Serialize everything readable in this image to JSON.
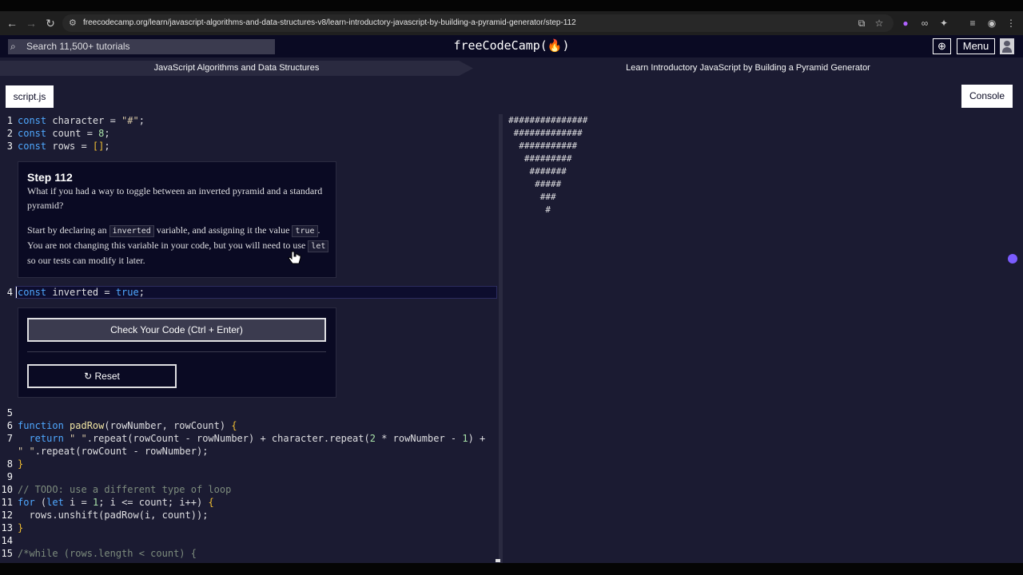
{
  "browser": {
    "url": "freecodecamp.org/learn/javascript-algorithms-and-data-structures-v8/learn-introductory-javascript-by-building-a-pyramid-generator/step-112"
  },
  "nav": {
    "search_placeholder": "Search 11,500+ tutorials",
    "brand": "freeCodeCamp(🔥)",
    "menu_label": "Menu"
  },
  "breadcrumb": {
    "superblock": "JavaScript Algorithms and Data Structures",
    "block": "Learn Introductory JavaScript by Building a Pyramid Generator"
  },
  "toolbar": {
    "file_tab": "script.js",
    "console_label": "Console"
  },
  "step": {
    "title": "Step 112",
    "p1": "What if you had a way to toggle between an inverted pyramid and a standard pyramid?",
    "p2_a": "Start by declaring an ",
    "p2_code1": "inverted",
    "p2_b": " variable, and assigning it the value ",
    "p2_code2": "true",
    "p2_c": ". You are not changing this variable in your code, but you will need to use ",
    "p2_code3": "let",
    "p2_d": " so our tests can modify it later."
  },
  "actions": {
    "check_label": "Check Your Code (Ctrl + Enter)",
    "reset_label": "Reset"
  },
  "line_numbers": [
    "1",
    "2",
    "3",
    "4",
    "5",
    "6",
    "7",
    "8",
    "9",
    "10",
    "11",
    "12",
    "13",
    "14",
    "15"
  ],
  "code": {
    "l1": [
      "const",
      " character = ",
      "\"#\"",
      ";"
    ],
    "l2": [
      "const",
      " count = ",
      "8",
      ";"
    ],
    "l3": [
      "const",
      " rows = ",
      "[]",
      ";"
    ],
    "l4": [
      "const",
      " inverted = ",
      "true",
      ";"
    ],
    "l6": [
      "function",
      " ",
      "padRow",
      "(rowNumber, rowCount) ",
      "{"
    ],
    "l7a": [
      "  return",
      " ",
      "\" \"",
      ".repeat(rowCount - rowNumber) + character.repeat(",
      "2",
      " * rowNumber - ",
      "1",
      ") +"
    ],
    "l7b": [
      "\" \"",
      ".repeat(rowCount - rowNumber);"
    ],
    "l8": [
      "}"
    ],
    "l10": [
      "// TODO: use a different type of loop"
    ],
    "l11": [
      "for",
      " (",
      "let",
      " i = ",
      "1",
      "; i <= count; i++) ",
      "{"
    ],
    "l12": [
      "  rows.unshift(padRow(i, count));"
    ],
    "l13": [
      "}"
    ],
    "l15": [
      "/*while (rows.length < count) {"
    ]
  },
  "console_output": [
    "###############",
    " #############",
    "  ###########",
    "   #########",
    "    #######",
    "     #####",
    "      ###",
    "       #"
  ]
}
